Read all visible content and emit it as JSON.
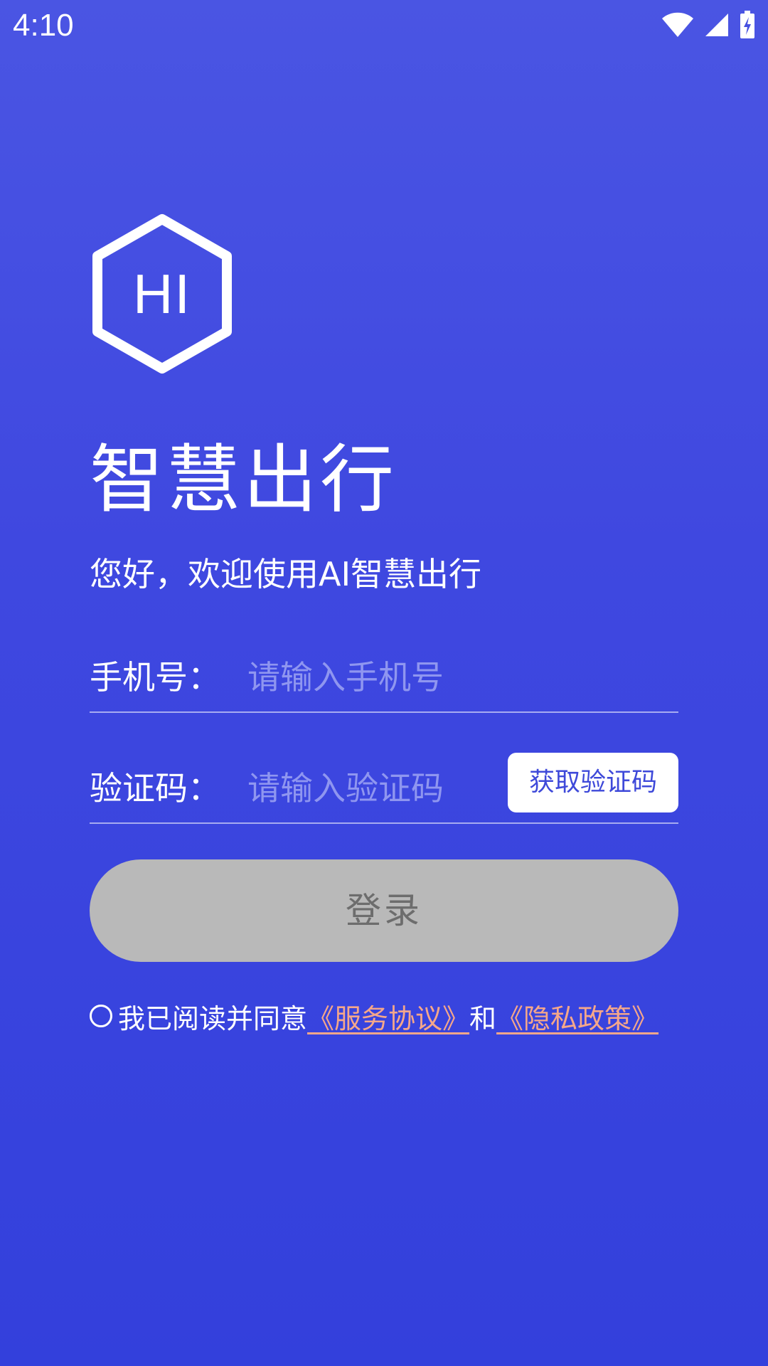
{
  "status_bar": {
    "time": "4:10",
    "icons": [
      "wifi-icon",
      "cellular-signal-icon",
      "battery-charging-icon"
    ]
  },
  "logo": {
    "text": "HI"
  },
  "header": {
    "title": "智慧出行",
    "welcome": "您好，欢迎使用AI智慧出行"
  },
  "form": {
    "phone": {
      "label": "手机号：",
      "placeholder": "请输入手机号"
    },
    "code": {
      "label": "验证码：",
      "placeholder": "请输入验证码",
      "get_code_label": "获取验证码"
    },
    "login_label": "登录"
  },
  "agreement": {
    "prefix": "我已阅读并同意",
    "service_link": "《服务协议》",
    "conjunction": "和",
    "privacy_link": "《隐私政策》"
  },
  "colors": {
    "background_top": "#4a55e3",
    "background_bottom": "#3340dc",
    "login_disabled_bg": "#b9b9b9",
    "link": "#f5a78a",
    "code_button_text": "#3e49d9"
  }
}
